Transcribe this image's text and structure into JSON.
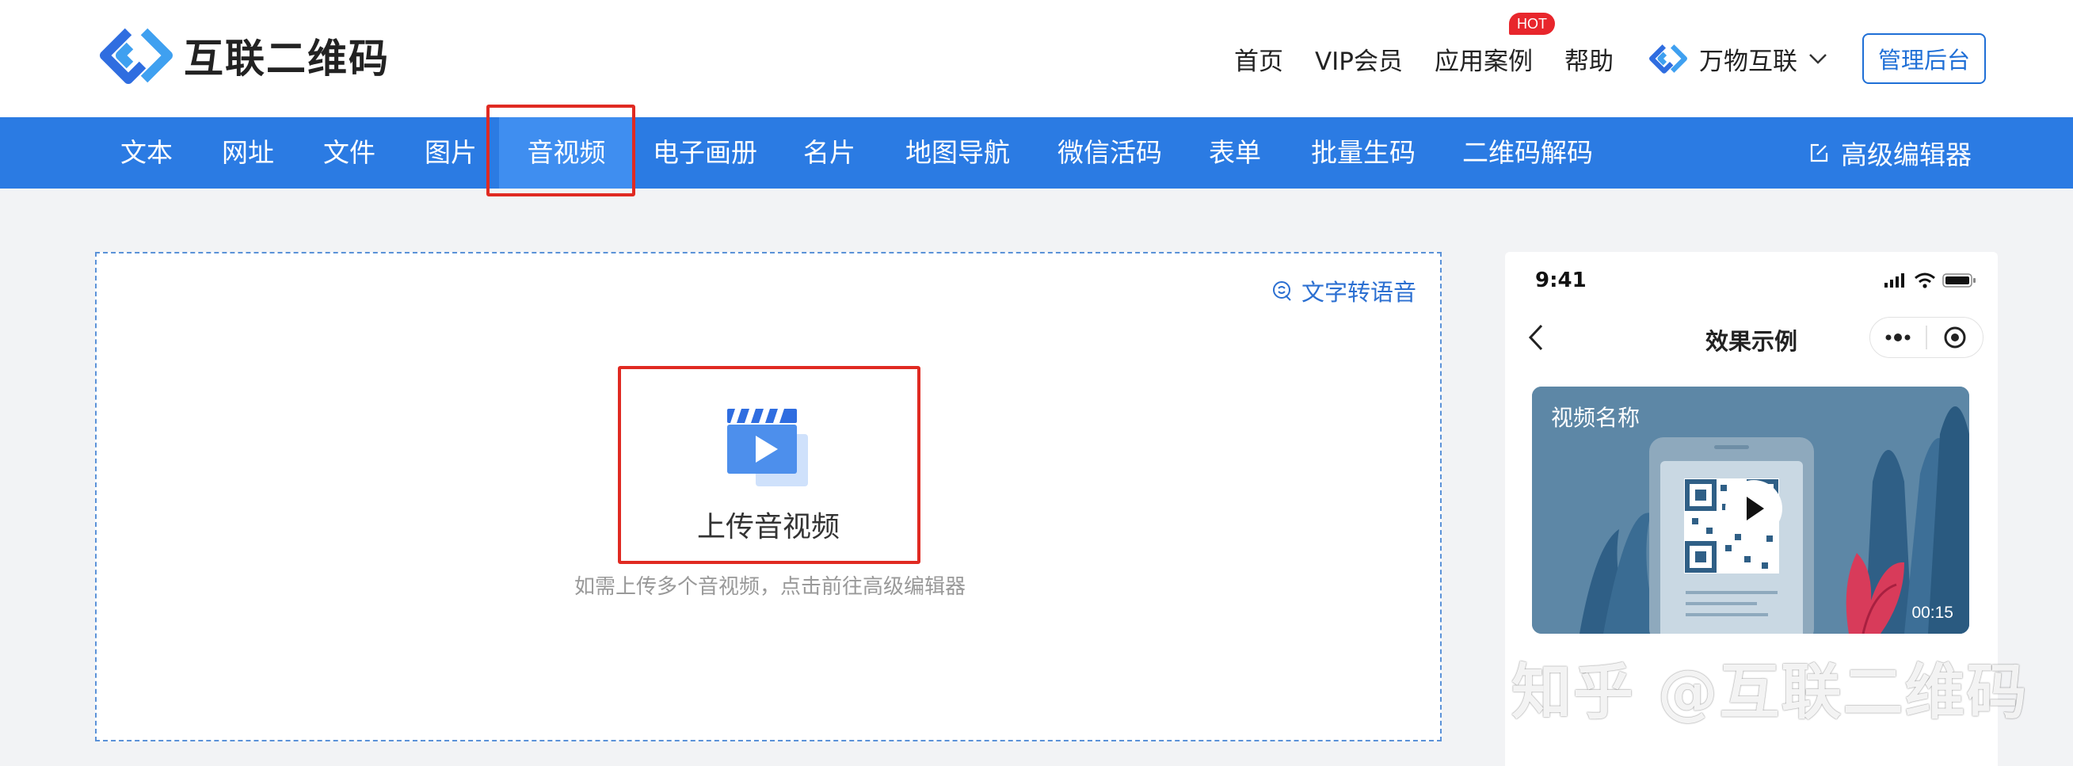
{
  "brand": {
    "name": "互联二维码"
  },
  "top_nav": {
    "links": [
      {
        "label": "首页"
      },
      {
        "label": "VIP会员"
      },
      {
        "label": "应用案例",
        "badge": "HOT"
      },
      {
        "label": "帮助"
      }
    ],
    "brand_switch": "万物互联",
    "admin_button": "管理后台"
  },
  "tabs": {
    "items": [
      "文本",
      "网址",
      "文件",
      "图片",
      "音视频",
      "电子画册",
      "名片",
      "地图导航",
      "微信活码",
      "表单",
      "批量生码",
      "二维码解码"
    ],
    "active": "音视频",
    "editor_link": "高级编辑器"
  },
  "upload": {
    "tts_link": "文字转语音",
    "button_label": "上传音视频",
    "hint": "如需上传多个音视频，点击前往高级编辑器"
  },
  "preview": {
    "status_time": "9:41",
    "title": "效果示例",
    "video_name": "视频名称",
    "video_duration": "00:15"
  },
  "watermark": "知乎 @互联二维码",
  "colors": {
    "primary": "#2b7be3",
    "highlight_box": "#e02a22",
    "hot_badge": "#e8262c"
  }
}
